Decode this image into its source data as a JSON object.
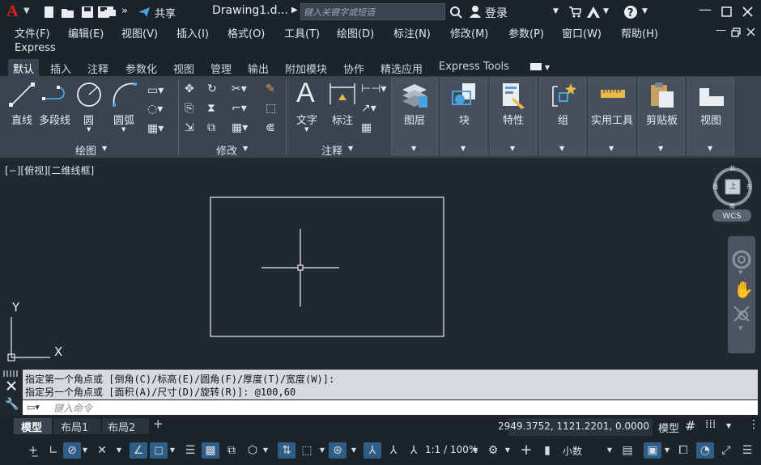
{
  "title": {
    "app_logo": "A",
    "share_label": "共享",
    "doc_name": "Drawing1.d...",
    "search_placeholder": "键入关键字或短语",
    "login_label": "登录"
  },
  "menu": [
    "文件(F)",
    "编辑(E)",
    "视图(V)",
    "插入(I)",
    "格式(O)",
    "工具(T)",
    "绘图(D)",
    "标注(N)",
    "修改(M)",
    "参数(P)",
    "窗口(W)",
    "帮助(H)"
  ],
  "menu_extra": "Express",
  "ribbon_tabs": [
    "默认",
    "插入",
    "注释",
    "参数化",
    "视图",
    "管理",
    "输出",
    "附加模块",
    "协作",
    "精选应用",
    "Express Tools"
  ],
  "ribbon": {
    "draw_tools": [
      "直线",
      "多段线",
      "圆",
      "圆弧"
    ],
    "draw_panel": "绘图",
    "modify_panel": "修改",
    "annot_tools": [
      "文字",
      "标注"
    ],
    "annot_panel": "注释",
    "big_panels": [
      "图层",
      "块",
      "特性",
      "组",
      "实用工具",
      "剪贴板",
      "视图"
    ]
  },
  "viewport": {
    "label": "[−][俯视][二维线框]",
    "wcs": "WCS",
    "compass": {
      "n": "北",
      "s": "南",
      "e": "东",
      "w": "西",
      "top": "上"
    },
    "ucs_x": "X",
    "ucs_y": "Y"
  },
  "command": {
    "line1": "指定第一个角点或 [倒角(C)/标高(E)/圆角(F)/厚度(T)/宽度(W)]:",
    "line2": "指定另一个角点或 [面积(A)/尺寸(D)/旋转(R)]: @100,60",
    "placeholder": "键入命令"
  },
  "layout_tabs": [
    "模型",
    "布局1",
    "布局2"
  ],
  "status": {
    "coords": "2949.3752, 1121.2201, 0.0000",
    "model_label": "模型",
    "scale": "1:1 / 100%",
    "units": "小数"
  },
  "colors": {
    "accent": "#2e5d86",
    "logo_red": "#e2231a",
    "bg_dark": "#1c232b",
    "ribbon": "#3a4350"
  }
}
